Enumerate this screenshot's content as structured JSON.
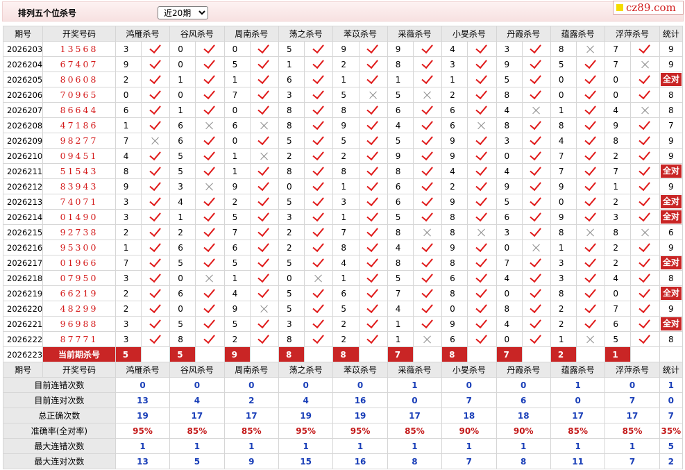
{
  "header": {
    "title": "排列五个位杀号",
    "period_select": "近20期",
    "logo_text": "cz89.com"
  },
  "columns": {
    "period": "期号",
    "draw": "开奖号码",
    "experts": [
      "鸿雁杀号",
      "谷风杀号",
      "周南杀号",
      "荡之杀号",
      "苯苡杀号",
      "采薇杀号",
      "小旻杀号",
      "丹霞杀号",
      "蕴露杀号",
      "浮萍杀号"
    ],
    "count": "统计"
  },
  "rows": [
    {
      "period": "2026203",
      "draw": "13568",
      "v": [
        "3",
        "0",
        "0",
        "5",
        "9",
        "9",
        "4",
        "3",
        "8",
        "7"
      ],
      "r": [
        1,
        1,
        1,
        1,
        1,
        1,
        1,
        1,
        0,
        1
      ],
      "count": "9"
    },
    {
      "period": "2026204",
      "draw": "67407",
      "v": [
        "9",
        "0",
        "5",
        "1",
        "2",
        "8",
        "3",
        "9",
        "5",
        "7"
      ],
      "r": [
        1,
        1,
        1,
        1,
        1,
        1,
        1,
        1,
        1,
        0
      ],
      "count": "9"
    },
    {
      "period": "2026205",
      "draw": "80608",
      "v": [
        "2",
        "1",
        "1",
        "6",
        "1",
        "1",
        "1",
        "5",
        "0",
        "0"
      ],
      "r": [
        1,
        1,
        1,
        1,
        1,
        1,
        1,
        1,
        1,
        1
      ],
      "count": "全对"
    },
    {
      "period": "2026206",
      "draw": "70965",
      "v": [
        "0",
        "0",
        "7",
        "3",
        "5",
        "5",
        "2",
        "8",
        "0",
        "0"
      ],
      "r": [
        1,
        1,
        1,
        1,
        0,
        0,
        1,
        1,
        1,
        1
      ],
      "count": "8"
    },
    {
      "period": "2026207",
      "draw": "86644",
      "v": [
        "6",
        "1",
        "0",
        "8",
        "8",
        "6",
        "6",
        "4",
        "1",
        "4"
      ],
      "r": [
        1,
        1,
        1,
        1,
        1,
        1,
        1,
        0,
        1,
        0
      ],
      "count": "8"
    },
    {
      "period": "2026208",
      "draw": "47186",
      "v": [
        "1",
        "6",
        "6",
        "8",
        "9",
        "4",
        "6",
        "8",
        "8",
        "9"
      ],
      "r": [
        1,
        0,
        0,
        1,
        1,
        1,
        0,
        1,
        1,
        1
      ],
      "count": "7"
    },
    {
      "period": "2026209",
      "draw": "98277",
      "v": [
        "7",
        "6",
        "0",
        "5",
        "5",
        "5",
        "9",
        "3",
        "4",
        "8"
      ],
      "r": [
        0,
        1,
        1,
        1,
        1,
        1,
        1,
        1,
        1,
        1
      ],
      "count": "9"
    },
    {
      "period": "2026210",
      "draw": "09451",
      "v": [
        "4",
        "5",
        "1",
        "2",
        "2",
        "9",
        "9",
        "0",
        "7",
        "2"
      ],
      "r": [
        1,
        1,
        0,
        1,
        1,
        1,
        1,
        1,
        1,
        1
      ],
      "count": "9"
    },
    {
      "period": "2026211",
      "draw": "51543",
      "v": [
        "8",
        "5",
        "1",
        "8",
        "8",
        "8",
        "4",
        "4",
        "7",
        "7"
      ],
      "r": [
        1,
        1,
        1,
        1,
        1,
        1,
        1,
        1,
        1,
        1
      ],
      "count": "全对"
    },
    {
      "period": "2026212",
      "draw": "83943",
      "v": [
        "9",
        "3",
        "9",
        "0",
        "1",
        "6",
        "2",
        "9",
        "9",
        "1"
      ],
      "r": [
        1,
        0,
        1,
        1,
        1,
        1,
        1,
        1,
        1,
        1
      ],
      "count": "9"
    },
    {
      "period": "2026213",
      "draw": "74071",
      "v": [
        "3",
        "4",
        "2",
        "5",
        "3",
        "6",
        "9",
        "5",
        "0",
        "2"
      ],
      "r": [
        1,
        1,
        1,
        1,
        1,
        1,
        1,
        1,
        1,
        1
      ],
      "count": "全对"
    },
    {
      "period": "2026214",
      "draw": "01490",
      "v": [
        "3",
        "1",
        "5",
        "3",
        "1",
        "5",
        "8",
        "6",
        "9",
        "3"
      ],
      "r": [
        1,
        1,
        1,
        1,
        1,
        1,
        1,
        1,
        1,
        1
      ],
      "count": "全对"
    },
    {
      "period": "2026215",
      "draw": "92738",
      "v": [
        "2",
        "2",
        "7",
        "2",
        "7",
        "8",
        "8",
        "3",
        "8",
        "8"
      ],
      "r": [
        1,
        1,
        1,
        1,
        1,
        0,
        0,
        1,
        0,
        0
      ],
      "count": "6"
    },
    {
      "period": "2026216",
      "draw": "95300",
      "v": [
        "1",
        "6",
        "6",
        "2",
        "8",
        "4",
        "9",
        "0",
        "1",
        "2"
      ],
      "r": [
        1,
        1,
        1,
        1,
        1,
        1,
        1,
        0,
        1,
        1
      ],
      "count": "9"
    },
    {
      "period": "2026217",
      "draw": "01966",
      "v": [
        "7",
        "5",
        "5",
        "5",
        "4",
        "8",
        "8",
        "7",
        "3",
        "2"
      ],
      "r": [
        1,
        1,
        1,
        1,
        1,
        1,
        1,
        1,
        1,
        1
      ],
      "count": "全对"
    },
    {
      "period": "2026218",
      "draw": "07950",
      "v": [
        "3",
        "0",
        "1",
        "0",
        "1",
        "5",
        "6",
        "4",
        "3",
        "4"
      ],
      "r": [
        1,
        0,
        1,
        0,
        1,
        1,
        1,
        1,
        1,
        1
      ],
      "count": "8"
    },
    {
      "period": "2026219",
      "draw": "66219",
      "v": [
        "2",
        "6",
        "4",
        "5",
        "6",
        "7",
        "8",
        "0",
        "8",
        "0"
      ],
      "r": [
        1,
        1,
        1,
        1,
        1,
        1,
        1,
        1,
        1,
        1
      ],
      "count": "全对"
    },
    {
      "period": "2026220",
      "draw": "48299",
      "v": [
        "2",
        "0",
        "9",
        "5",
        "5",
        "4",
        "0",
        "8",
        "2",
        "7"
      ],
      "r": [
        1,
        1,
        0,
        1,
        1,
        1,
        1,
        1,
        1,
        1
      ],
      "count": "9"
    },
    {
      "period": "2026221",
      "draw": "96988",
      "v": [
        "3",
        "5",
        "5",
        "3",
        "2",
        "1",
        "9",
        "4",
        "2",
        "6"
      ],
      "r": [
        1,
        1,
        1,
        1,
        1,
        1,
        1,
        1,
        1,
        1
      ],
      "count": "全对"
    },
    {
      "period": "2026222",
      "draw": "87771",
      "v": [
        "3",
        "8",
        "2",
        "8",
        "2",
        "1",
        "6",
        "0",
        "1",
        "5"
      ],
      "r": [
        1,
        1,
        1,
        1,
        1,
        0,
        1,
        1,
        0,
        1
      ],
      "count": "8"
    }
  ],
  "current": {
    "period": "2026223",
    "label": "当前期杀号",
    "v": [
      "5",
      "5",
      "9",
      "8",
      "8",
      "7",
      "8",
      "7",
      "2",
      "1"
    ]
  },
  "stats": [
    {
      "label": "目前连错次数",
      "v": [
        "0",
        "0",
        "0",
        "0",
        "0",
        "1",
        "0",
        "0",
        "1",
        "0"
      ],
      "count": "1",
      "red": false
    },
    {
      "label": "目前连对次数",
      "v": [
        "13",
        "4",
        "2",
        "4",
        "16",
        "0",
        "7",
        "6",
        "0",
        "7"
      ],
      "count": "0",
      "red": false
    },
    {
      "label": "总正确次数",
      "v": [
        "19",
        "17",
        "17",
        "19",
        "19",
        "17",
        "18",
        "18",
        "17",
        "17"
      ],
      "count": "7",
      "red": false
    },
    {
      "label": "准确率(全对率)",
      "v": [
        "95%",
        "85%",
        "85%",
        "95%",
        "95%",
        "85%",
        "90%",
        "90%",
        "85%",
        "85%"
      ],
      "count": "35%",
      "red": true
    },
    {
      "label": "最大连错次数",
      "v": [
        "1",
        "1",
        "1",
        "1",
        "1",
        "1",
        "1",
        "1",
        "1",
        "1"
      ],
      "count": "5",
      "red": false
    },
    {
      "label": "最大连对次数",
      "v": [
        "13",
        "5",
        "9",
        "15",
        "16",
        "8",
        "7",
        "8",
        "11",
        "7"
      ],
      "count": "2",
      "red": false
    }
  ],
  "colors": {
    "red": "#c92525",
    "blue": "#1a3fb8",
    "header_bg": "#e9e9e9"
  }
}
